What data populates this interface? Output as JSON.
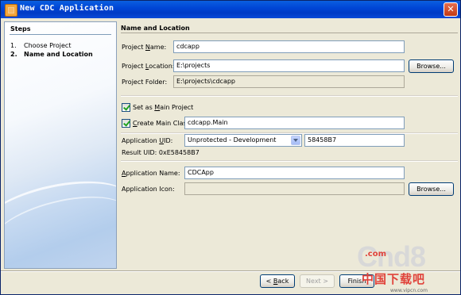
{
  "window": {
    "title": "New CDC Application",
    "close_glyph": "✕"
  },
  "steps": {
    "title": "Steps",
    "items": [
      {
        "num": "1.",
        "label": "Choose Project"
      },
      {
        "num": "2.",
        "label": "Name and Location"
      }
    ]
  },
  "panel": {
    "title": "Name and Location",
    "project_name": {
      "label_pre": "Project ",
      "label_key": "N",
      "label_post": "ame:",
      "value": "cdcapp"
    },
    "project_location": {
      "label_pre": "Project ",
      "label_key": "L",
      "label_post": "ocation:",
      "value": "E:\\projects",
      "browse": "Browse..."
    },
    "project_folder": {
      "label": "Project Folder:",
      "value": "E:\\projects\\cdcapp"
    },
    "set_main": {
      "label_pre": "Set as ",
      "label_key": "M",
      "label_post": "ain Project",
      "checked": true
    },
    "create_main": {
      "label_pre": "",
      "label_key": "C",
      "label_post": "reate Main Class",
      "checked": true,
      "value": "cdcapp.Main"
    },
    "app_uid": {
      "label_pre": "Application ",
      "label_key": "U",
      "label_post": "ID:",
      "selected": "Unprotected - Development",
      "value": "58458B7"
    },
    "result_uid": "Result UID: 0xE58458B7",
    "app_name": {
      "label_pre": "",
      "label_key": "A",
      "label_post": "pplication Name:",
      "value": "CDCApp"
    },
    "app_icon": {
      "label": "Application Icon:",
      "value": "",
      "browse": "Browse..."
    }
  },
  "buttons": {
    "back_pre": "< ",
    "back_key": "B",
    "back_post": "ack",
    "next": "Next >",
    "finish": "Finish"
  },
  "watermark": {
    "text": "Cnd8",
    "com": ".com",
    "cn": "中国下载吧",
    "url": "www.vipcn.com"
  },
  "colors": {
    "titlebar": "#0046d6",
    "dialog_bg": "#ece9d8",
    "input_border": "#7f9db9"
  }
}
